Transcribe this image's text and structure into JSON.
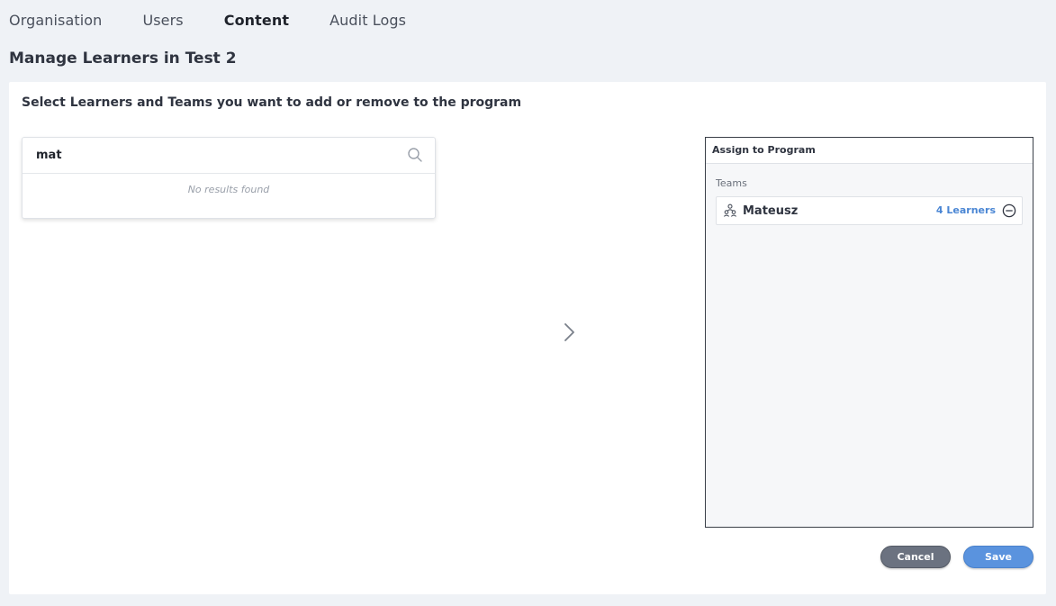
{
  "nav": {
    "tabs": [
      {
        "label": "Organisation",
        "active": false
      },
      {
        "label": "Users",
        "active": false
      },
      {
        "label": "Content",
        "active": true
      },
      {
        "label": "Audit Logs",
        "active": false
      }
    ]
  },
  "page": {
    "title": "Manage Learners in Test 2",
    "instructions": "Select Learners and Teams you want to add or remove to the program"
  },
  "search": {
    "value": "mat",
    "icon": "search-icon",
    "no_results": "No results found"
  },
  "transfer": {
    "icon": "chevron-right-icon"
  },
  "assign": {
    "header": "Assign to Program",
    "teams_label": "Teams",
    "teams": [
      {
        "name": "Mateusz",
        "count_label": "4 Learners",
        "icon": "team-icon",
        "remove_icon": "minus-circle-icon"
      }
    ]
  },
  "actions": {
    "cancel_label": "Cancel",
    "save_label": "Save"
  },
  "colors": {
    "background": "#eff2f6",
    "accent": "#5a93de",
    "link": "#4a86d4",
    "cancel": "#6b7280"
  }
}
